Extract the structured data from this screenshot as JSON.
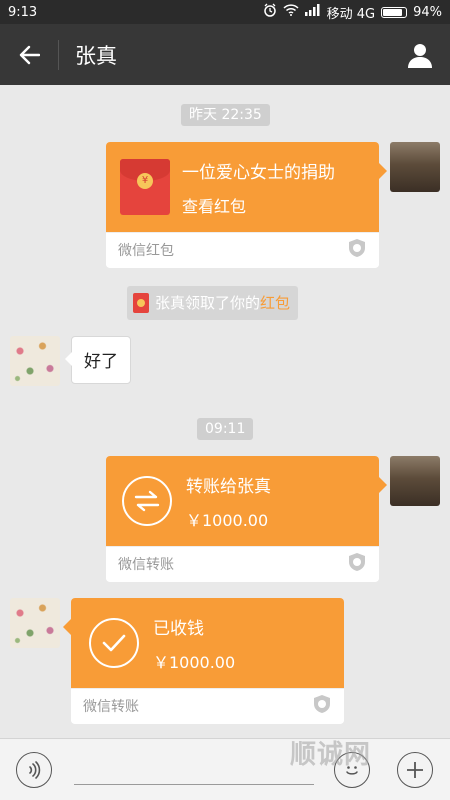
{
  "status_bar": {
    "time": "9:13",
    "carrier": "移动 4G",
    "battery": "94%",
    "battery_level": 0.94
  },
  "header": {
    "title": "张真"
  },
  "messages": {
    "time1": "昨天 22:35",
    "red_packet": {
      "title": "一位爱心女士的捐助",
      "action": "查看红包",
      "footer": "微信红包"
    },
    "notice": {
      "text": "张真领取了你的",
      "link": "红包"
    },
    "reply": "好了",
    "time2": "09:11",
    "transfer": {
      "title": "转账给张真",
      "amount": "￥1000.00",
      "footer": "微信转账"
    },
    "received": {
      "title": "已收钱",
      "amount": "￥1000.00",
      "footer": "微信转账"
    }
  },
  "watermark": "顺诚网",
  "colors": {
    "accent": "#f89c37",
    "header_bg": "#373737",
    "chat_bg": "#e9e9e9"
  }
}
